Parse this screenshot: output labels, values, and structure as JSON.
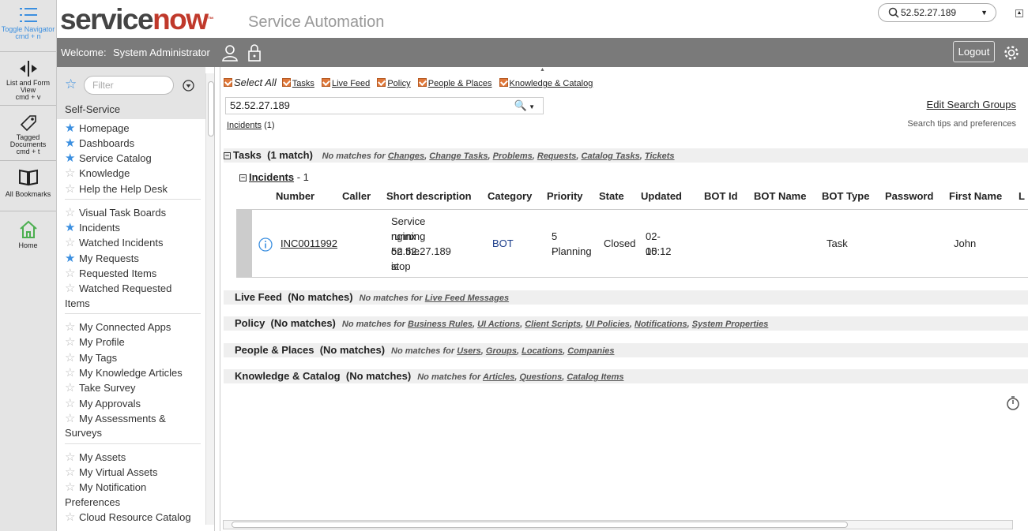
{
  "leftbar": {
    "items": [
      {
        "label": "Toggle Navigator",
        "shortcut": "cmd + n",
        "icon": "list-icon"
      },
      {
        "label": "List and Form View",
        "shortcut": "cmd + v",
        "icon": "split-view-icon"
      },
      {
        "label": "Tagged Documents",
        "shortcut": "cmd + t",
        "icon": "tag-icon"
      },
      {
        "label": "All Bookmarks",
        "icon": "book-icon"
      },
      {
        "label": "Home",
        "icon": "home-icon"
      }
    ]
  },
  "header": {
    "logo_service": "service",
    "logo_now": "now",
    "logo_tm": "™",
    "product": "Service Automation",
    "search_value": "52.52.27.189"
  },
  "welcome": {
    "label": "Welcome:",
    "user": "System Administrator",
    "logout": "Logout"
  },
  "nav": {
    "filter_placeholder": "Filter",
    "section": "Self-Service",
    "items": [
      {
        "label": "Homepage",
        "fav": true
      },
      {
        "label": "Dashboards",
        "fav": true
      },
      {
        "label": "Service Catalog",
        "fav": true
      },
      {
        "label": "Knowledge",
        "fav": false
      },
      {
        "label": "Help the Help Desk",
        "fav": false
      },
      {
        "label": "Visual Task Boards",
        "fav": false
      },
      {
        "label": "Incidents",
        "fav": true
      },
      {
        "label": "Watched Incidents",
        "fav": false
      },
      {
        "label": "My Requests",
        "fav": true
      },
      {
        "label": "Requested Items",
        "fav": false
      },
      {
        "label": "Watched Requested",
        "fav": false
      },
      {
        "label": "Items",
        "fav": null
      },
      {
        "label": "My Connected Apps",
        "fav": false
      },
      {
        "label": "My Profile",
        "fav": false
      },
      {
        "label": "My Tags",
        "fav": false
      },
      {
        "label": "My Knowledge Articles",
        "fav": false
      },
      {
        "label": "Take Survey",
        "fav": false
      },
      {
        "label": "My Approvals",
        "fav": false
      },
      {
        "label": "My Assessments &",
        "fav": false
      },
      {
        "label": "Surveys",
        "fav": null
      },
      {
        "label": "My Assets",
        "fav": false
      },
      {
        "label": "My Virtual Assets",
        "fav": false
      },
      {
        "label": "My Notification",
        "fav": false
      },
      {
        "label": "Preferences",
        "fav": null
      },
      {
        "label": "Cloud Resource Catalog",
        "fav": false
      }
    ]
  },
  "search": {
    "select_all": "Select All",
    "groups": [
      "Tasks",
      "Live Feed",
      "Policy",
      "People & Places",
      "Knowledge & Catalog"
    ],
    "query": "52.52.27.189",
    "edit_groups": "Edit Search Groups",
    "tips": "Search tips and preferences",
    "incidents_link": "Incidents",
    "incidents_count": "(1)"
  },
  "results": {
    "tasks": {
      "title": "Tasks",
      "count": "(1 match)",
      "no_match_prefix": "No matches for",
      "no_match": [
        "Changes",
        "Change Tasks",
        "Problems",
        "Requests",
        "Catalog Tasks",
        "Tickets"
      ]
    },
    "incidents": {
      "title": "Incidents",
      "count": "- 1",
      "columns": [
        "Number",
        "Caller",
        "Short description",
        "Category",
        "Priority",
        "State",
        "Updated",
        "BOT Id",
        "BOT Name",
        "BOT Type",
        "Password",
        "First Name",
        "L"
      ],
      "row": {
        "number": "INC0011992",
        "caller": "",
        "desc": [
          "Service nginx",
          "running on the",
          "52.52.27.189 is",
          "stop"
        ],
        "category": "BOT",
        "priority": [
          "5 -",
          "Planning"
        ],
        "state": "Closed",
        "updated": [
          "02-15",
          "00:12"
        ],
        "bot_type": "Task",
        "first_name": "John"
      }
    },
    "others": [
      {
        "title": "Live Feed",
        "count": "(No matches)",
        "no_match": [
          "Live Feed Messages"
        ]
      },
      {
        "title": "Policy",
        "count": "(No matches)",
        "no_match": [
          "Business Rules",
          "UI Actions",
          "Client Scripts",
          "UI Policies",
          "Notifications",
          "System Properties"
        ]
      },
      {
        "title": "People & Places",
        "count": "(No matches)",
        "no_match": [
          "Users",
          "Groups",
          "Locations",
          "Companies"
        ]
      },
      {
        "title": "Knowledge & Catalog",
        "count": "(No matches)",
        "no_match": [
          "Articles",
          "Questions",
          "Catalog Items"
        ]
      }
    ]
  }
}
